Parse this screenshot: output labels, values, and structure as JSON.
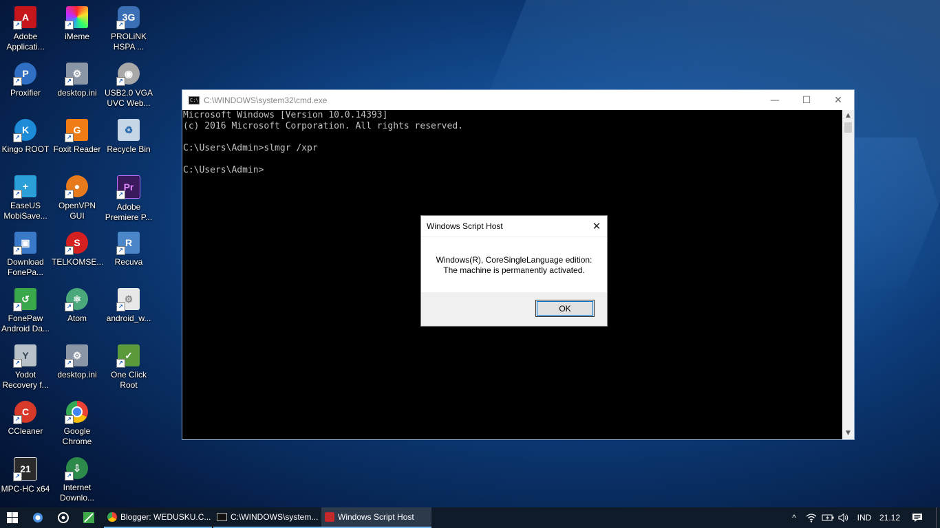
{
  "desktop": {
    "icons": [
      {
        "label": "Adobe Applicati...",
        "icon": "adobe-acrobat-icon",
        "color": "#c4161c",
        "glyph": "A"
      },
      {
        "label": "iMeme",
        "icon": "imeme-icon",
        "color": "#e040a0",
        "glyph": ""
      },
      {
        "label": "PROLiNK HSPA ...",
        "icon": "prolink-3g-icon",
        "color": "#3a6fb5",
        "glyph": "3G"
      },
      {
        "label": "Proxifier",
        "icon": "proxifier-icon",
        "color": "#2f6fc4",
        "glyph": "P"
      },
      {
        "label": "desktop.ini",
        "icon": "settings-file-icon",
        "color": "#8a96a6",
        "glyph": "⚙"
      },
      {
        "label": "USB2.0 VGA UVC Web...",
        "icon": "webcam-icon",
        "color": "#a8a8a8",
        "glyph": "◉"
      },
      {
        "label": "Kingo ROOT",
        "icon": "kingo-root-icon",
        "color": "#1e8bd8",
        "glyph": "K"
      },
      {
        "label": "Foxit Reader",
        "icon": "foxit-reader-icon",
        "color": "#f07c16",
        "glyph": "G"
      },
      {
        "label": "Recycle Bin",
        "icon": "recycle-bin-icon",
        "color": "#c7d6e6",
        "glyph": "♻"
      },
      {
        "label": "EaseUS MobiSave...",
        "icon": "easeus-icon",
        "color": "#2a9fd8",
        "glyph": "+"
      },
      {
        "label": "OpenVPN GUI",
        "icon": "openvpn-icon",
        "color": "#e87a1e",
        "glyph": "●"
      },
      {
        "label": "Adobe Premiere P...",
        "icon": "adobe-premiere-icon",
        "color": "#3a1a5c",
        "glyph": "Pr"
      },
      {
        "label": "Download FonePa...",
        "icon": "download-fonepaw-icon",
        "color": "#3a78c8",
        "glyph": "▣"
      },
      {
        "label": "TELKOMSE...",
        "icon": "telkomsel-icon",
        "color": "#d42020",
        "glyph": "S"
      },
      {
        "label": "Recuva",
        "icon": "recuva-icon",
        "color": "#4a86c8",
        "glyph": "R"
      },
      {
        "label": "FonePaw Android Da...",
        "icon": "fonepaw-icon",
        "color": "#3aa84a",
        "glyph": "↺"
      },
      {
        "label": "Atom",
        "icon": "atom-icon",
        "color": "#4aa87a",
        "glyph": "⚛"
      },
      {
        "label": "android_w...",
        "icon": "android-file-icon",
        "color": "#e8e8e8",
        "glyph": "⚙"
      },
      {
        "label": "Yodot Recovery f...",
        "icon": "yodot-icon",
        "color": "#b8c0c8",
        "glyph": "Y"
      },
      {
        "label": "desktop.ini",
        "icon": "settings-file-icon",
        "color": "#8a96a6",
        "glyph": "⚙"
      },
      {
        "label": "One Click Root",
        "icon": "one-click-root-icon",
        "color": "#5a9a3a",
        "glyph": "✓"
      },
      {
        "label": "CCleaner",
        "icon": "ccleaner-icon",
        "color": "#d83a2a",
        "glyph": "C"
      },
      {
        "label": "Google Chrome",
        "icon": "google-chrome-icon",
        "color": "#4285f4",
        "glyph": "◎"
      },
      {
        "label": "",
        "icon": "empty-slot",
        "color": "",
        "glyph": ""
      },
      {
        "label": "MPC-HC x64",
        "icon": "mpc-hc-icon",
        "color": "#2a2a2a",
        "glyph": "21"
      },
      {
        "label": "Internet Downlo...",
        "icon": "internet-download-manager-icon",
        "color": "#2c8a4a",
        "glyph": "⇩"
      }
    ]
  },
  "cmd": {
    "title": "C:\\WINDOWS\\system32\\cmd.exe",
    "icon": "cmd-icon",
    "icon_text": "C:\\",
    "minimize": "—",
    "maximize": "☐",
    "close": "✕",
    "output": "Microsoft Windows [Version 10.0.14393]\n(c) 2016 Microsoft Corporation. All rights reserved.\n\nC:\\Users\\Admin>slmgr /xpr\n\nC:\\Users\\Admin>"
  },
  "dialog": {
    "title": "Windows Script Host",
    "close": "✕",
    "message_line1": "Windows(R), CoreSingleLanguage edition:",
    "message_line2": "The machine is permanently activated.",
    "ok_label": "OK"
  },
  "taskbar": {
    "start_icon": "windows-start-icon",
    "pinned": [
      {
        "icon": "cortana-icon"
      },
      {
        "icon": "task-view-icon"
      },
      {
        "icon": "pinned-app-icon"
      }
    ],
    "apps": [
      {
        "label": "Blogger: WEDUSKU.C...",
        "icon": "chrome-icon",
        "state": "open"
      },
      {
        "label": "C:\\WINDOWS\\system...",
        "icon": "cmd-icon",
        "state": "open"
      },
      {
        "label": "Windows Script Host",
        "icon": "script-host-icon",
        "state": "active"
      }
    ],
    "tray": {
      "language": "IND",
      "time": "21.12",
      "chevron": "^"
    }
  },
  "colors": {
    "desktop_accent": "#1a5aa8",
    "taskbar": "#101b2a",
    "taskbar_accent": "#76b9ed",
    "cmd_text": "#c0c0c0",
    "focus_outline": "#0078d7"
  }
}
